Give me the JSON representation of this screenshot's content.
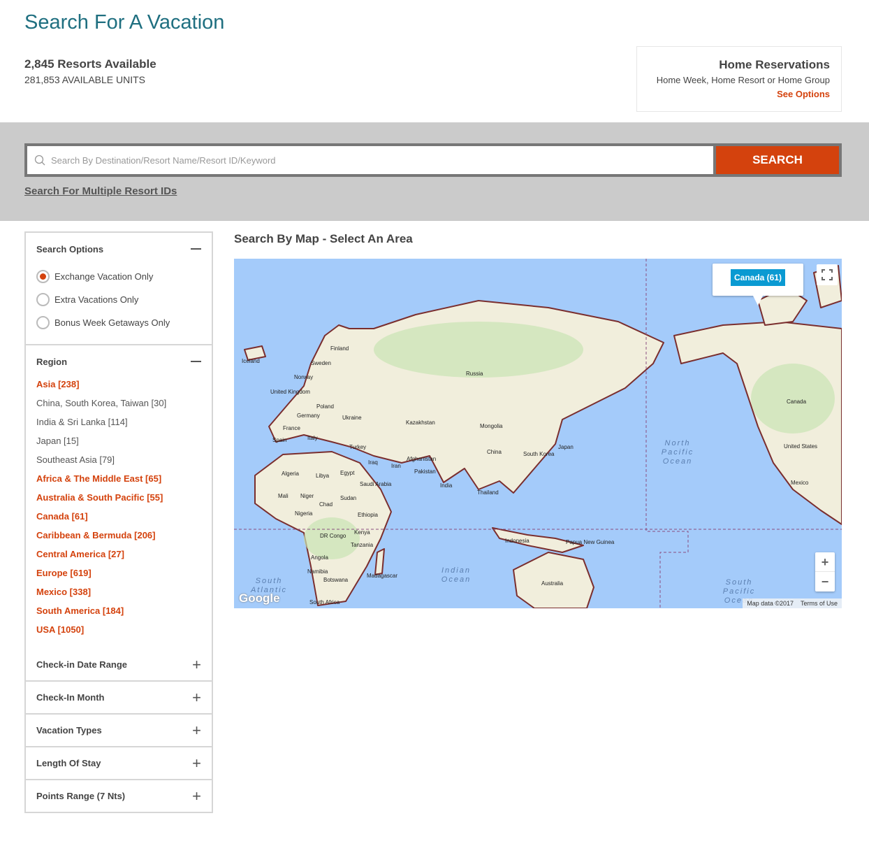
{
  "page_title": "Search For A Vacation",
  "stats": {
    "resorts": "2,845 Resorts Available",
    "units": "281,853 AVAILABLE UNITS"
  },
  "home": {
    "title": "Home Reservations",
    "subtitle": "Home Week, Home Resort or Home Group",
    "link": "See Options"
  },
  "search": {
    "placeholder": "Search By Destination/Resort Name/Resort ID/Keyword",
    "button": "SEARCH",
    "multi_link": "Search For Multiple Resort IDs"
  },
  "sidebar": {
    "search_options": {
      "title": "Search Options",
      "options": [
        {
          "label": "Exchange Vacation Only",
          "selected": true
        },
        {
          "label": "Extra Vacations Only",
          "selected": false
        },
        {
          "label": "Bonus Week Getaways Only",
          "selected": false
        }
      ]
    },
    "region": {
      "title": "Region",
      "items": [
        {
          "label": "Asia [238]",
          "top": true
        },
        {
          "label": "China, South Korea, Taiwan [30]",
          "top": false
        },
        {
          "label": "India & Sri Lanka [114]",
          "top": false
        },
        {
          "label": "Japan [15]",
          "top": false
        },
        {
          "label": "Southeast Asia [79]",
          "top": false
        },
        {
          "label": "Africa & The Middle East [65]",
          "top": true
        },
        {
          "label": "Australia & South Pacific [55]",
          "top": true
        },
        {
          "label": "Canada [61]",
          "top": true
        },
        {
          "label": "Caribbean & Bermuda [206]",
          "top": true
        },
        {
          "label": "Central America [27]",
          "top": true
        },
        {
          "label": "Europe [619]",
          "top": true
        },
        {
          "label": "Mexico [338]",
          "top": true
        },
        {
          "label": "South America [184]",
          "top": true
        },
        {
          "label": "USA [1050]",
          "top": true
        }
      ]
    },
    "collapsed": [
      "Check-in Date Range",
      "Check-In Month",
      "Vacation Types",
      "Length Of Stay",
      "Points Range (7 Nts)"
    ]
  },
  "map": {
    "title": "Search By Map - Select An Area",
    "popup": "Canada (61)",
    "zoom_in": "+",
    "zoom_out": "−",
    "attribution": "Map data ©2017",
    "terms": "Terms of Use",
    "logo": "Google",
    "labels": [
      "Iceland",
      "Finland",
      "Sweden",
      "Norway",
      "United Kingdom",
      "Poland",
      "Germany",
      "Ukraine",
      "France",
      "Spain",
      "Italy",
      "Turkey",
      "Kazakhstan",
      "Russia",
      "Mongolia",
      "China",
      "South Korea",
      "Japan",
      "Afghanistan",
      "Pakistan",
      "Iran",
      "Iraq",
      "India",
      "Thailand",
      "Algeria",
      "Libya",
      "Egypt",
      "Saudi Arabia",
      "Mali",
      "Niger",
      "Chad",
      "Sudan",
      "Nigeria",
      "Ethiopia",
      "DR Congo",
      "Kenya",
      "Tanzania",
      "Angola",
      "Namibia",
      "Botswana",
      "South Africa",
      "Madagascar",
      "Indonesia",
      "Papua New Guinea",
      "Australia",
      "Canada",
      "United States",
      "Mexico"
    ],
    "oceans": [
      "North Pacific Ocean",
      "Indian Ocean",
      "South Atlantic",
      "South Pacific Ocean"
    ]
  },
  "colors": {
    "accent": "#d4420d",
    "title": "#1f6f80",
    "popup": "#0a9ad2",
    "water": "#a4cbfa",
    "land": "#f1eedc",
    "border": "#7a2e2e"
  }
}
